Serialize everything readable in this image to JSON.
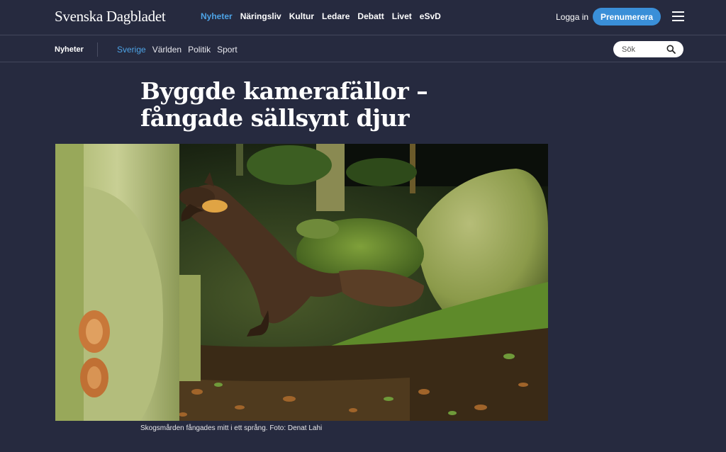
{
  "header": {
    "logo": "Svenska Dagbladet",
    "nav": [
      "Nyheter",
      "Näringsliv",
      "Kultur",
      "Ledare",
      "Debatt",
      "Livet",
      "eSvD"
    ],
    "active_nav": "Nyheter",
    "login_label": "Logga in",
    "subscribe_label": "Prenumerera",
    "menu_icon": "hamburger-icon"
  },
  "subheader": {
    "section": "Nyheter",
    "items": [
      "Sverige",
      "Världen",
      "Politik",
      "Sport"
    ],
    "active_item": "Sverige",
    "search_placeholder": "Sök",
    "search_icon": "search-icon"
  },
  "article": {
    "headline_line1": "Byggde kamerafällor –",
    "headline_line2": "fångade sällsynt djur",
    "caption": "Skogsmården fångades mitt i ett språng. Foto: Denat Lahi"
  },
  "colors": {
    "background": "#262a3f",
    "accent": "#4da3e6",
    "subscribe_button": "#3a8fd8"
  }
}
